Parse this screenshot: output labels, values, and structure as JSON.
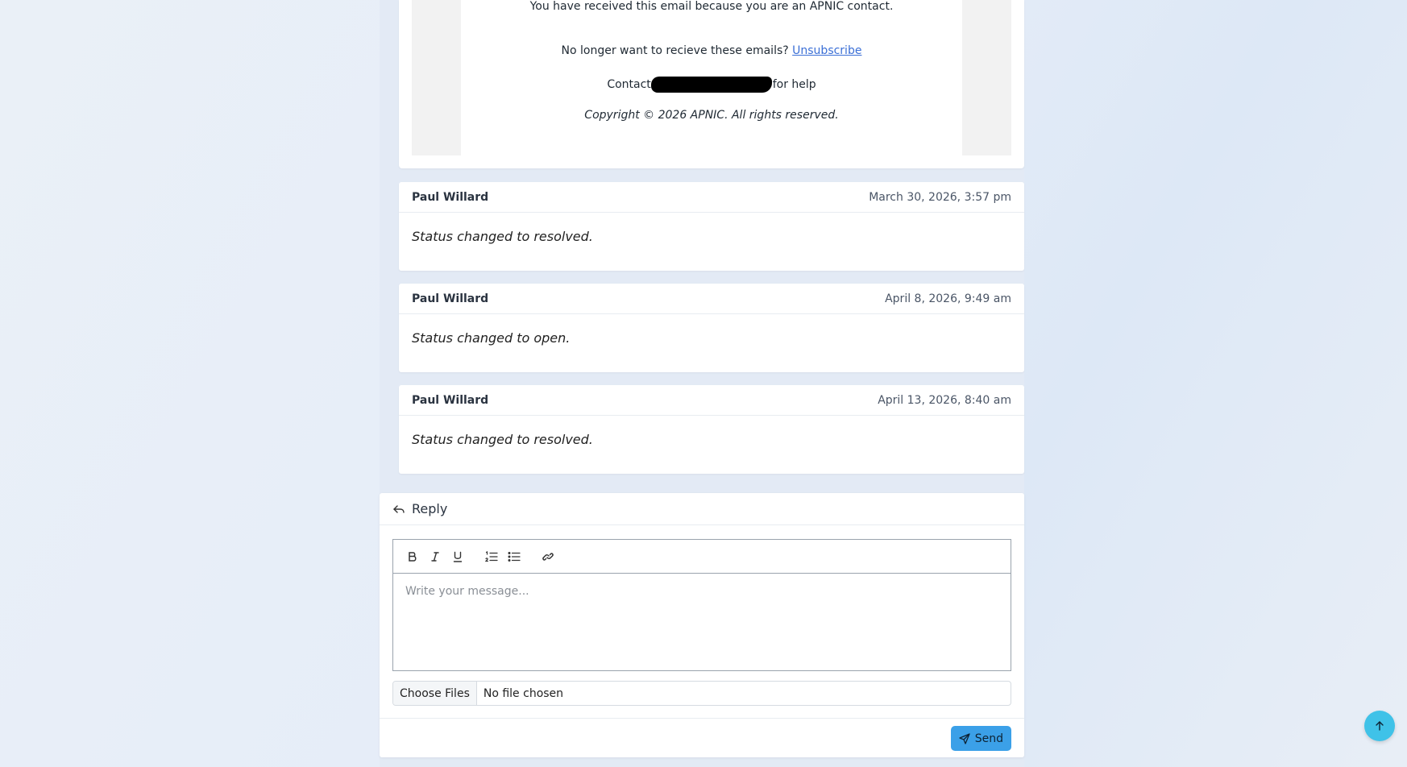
{
  "email": {
    "line_received": "You have received this email because you are an APNIC contact.",
    "unsubscribe_prefix": "No longer want to recieve these emails?",
    "unsubscribe_link": "Unsubscribe",
    "contact_prefix": "Contact",
    "contact_suffix": "for help",
    "copyright": "Copyright © 2026 APNIC. All rights reserved."
  },
  "activity": [
    {
      "author": "Paul Willard",
      "date": "March 30, 2026, 3:57 pm",
      "text": "Status changed to resolved."
    },
    {
      "author": "Paul Willard",
      "date": "April 8, 2026, 9:49 am",
      "text": "Status changed to open."
    },
    {
      "author": "Paul Willard",
      "date": "April 13, 2026, 8:40 am",
      "text": "Status changed to resolved."
    }
  ],
  "reply": {
    "title": "Reply",
    "placeholder": "Write your message...",
    "choose_files": "Choose Files",
    "no_file": "No file chosen",
    "send_label": "Send",
    "toolbar": [
      "bold-icon",
      "italic-icon",
      "underline-icon",
      "ordered-list-icon",
      "bullet-list-icon",
      "link-icon"
    ]
  },
  "colors": {
    "accent": "#3ba0e8",
    "scroll_top": "#3fc2e8",
    "link": "#3b6fd6"
  }
}
